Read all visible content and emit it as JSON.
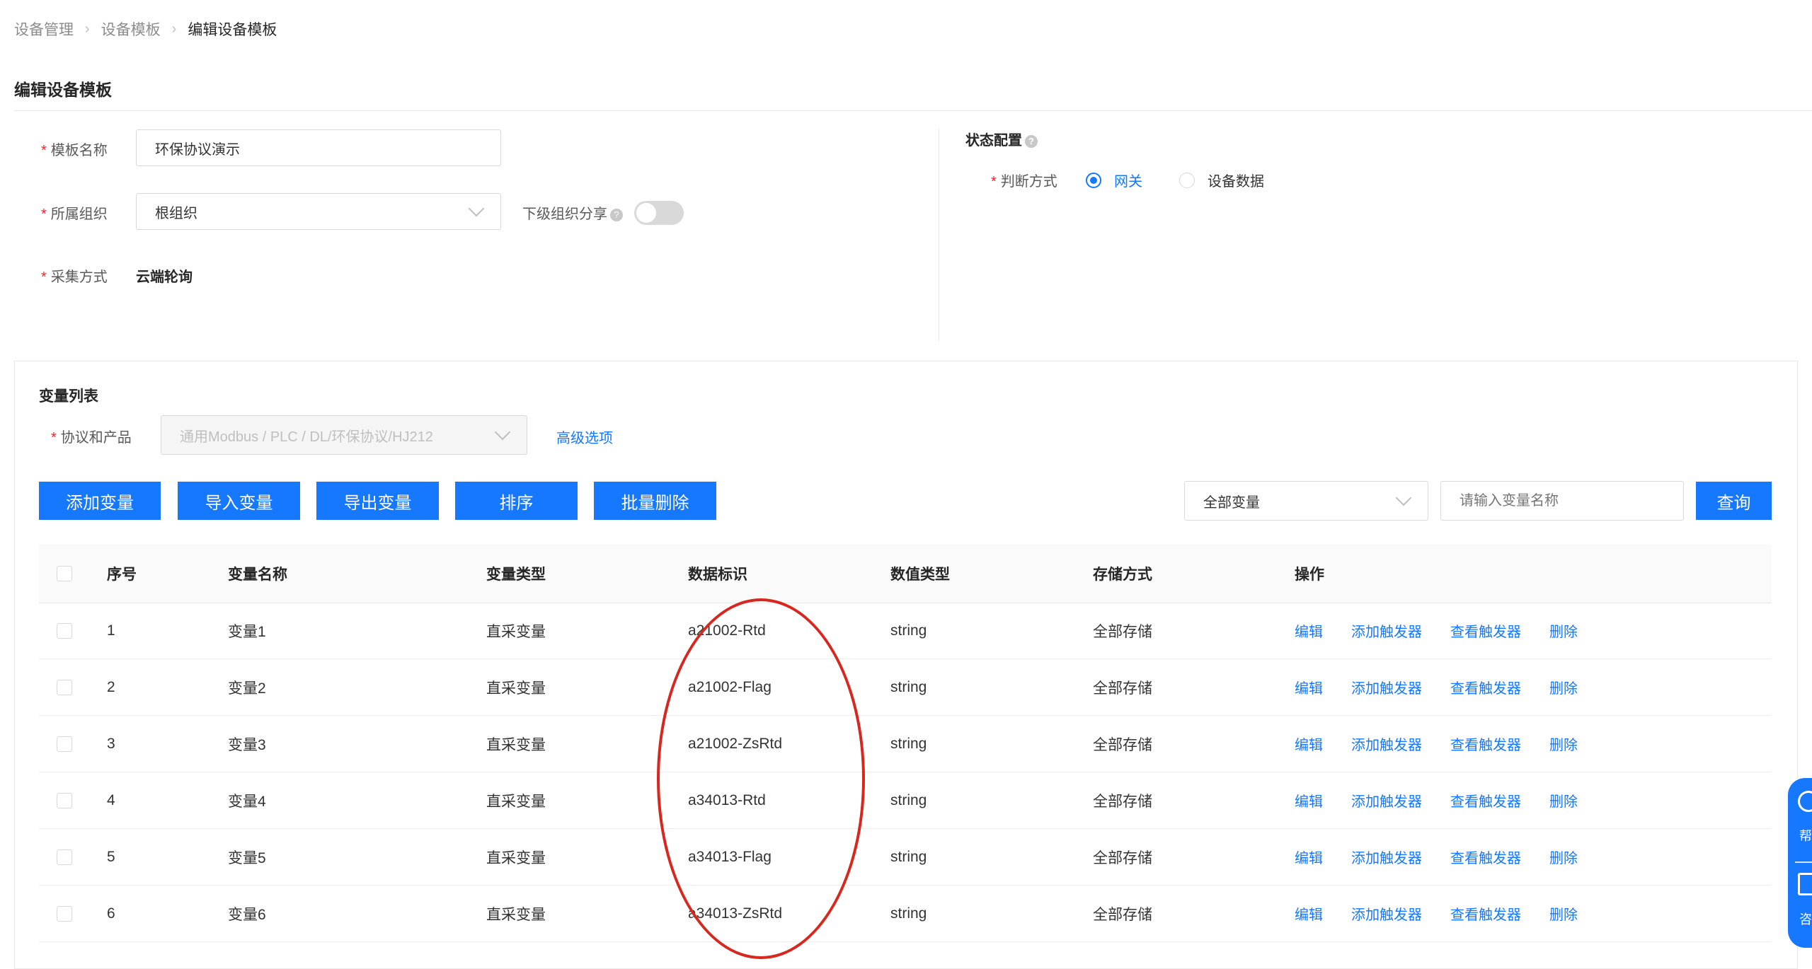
{
  "breadcrumb": {
    "items": [
      "设备管理",
      "设备模板"
    ],
    "current": "编辑设备模板"
  },
  "page": {
    "title": "编辑设备模板"
  },
  "form": {
    "template_name": {
      "label": "模板名称",
      "value": "环保协议演示"
    },
    "org": {
      "label": "所属组织",
      "value": "根组织"
    },
    "sub_share": {
      "label": "下级组织分享",
      "enabled": false
    },
    "collect": {
      "label": "采集方式",
      "value": "云端轮询"
    }
  },
  "status_config": {
    "title": "状态配置",
    "judge_label": "判断方式",
    "options": [
      {
        "label": "网关",
        "selected": true
      },
      {
        "label": "设备数据",
        "selected": false
      }
    ]
  },
  "variables": {
    "section_title": "变量列表",
    "protocol": {
      "label": "协议和产品",
      "placeholder": "通用Modbus / PLC / DL/环保协议/HJ212"
    },
    "advanced_link": "高级选项",
    "buttons": {
      "add": "添加变量",
      "import": "导入变量",
      "export": "导出变量",
      "sort": "排序",
      "batch_delete": "批量删除"
    },
    "filter": {
      "value": "全部变量"
    },
    "search": {
      "placeholder": "请输入变量名称",
      "button": "查询"
    },
    "columns": [
      "序号",
      "变量名称",
      "变量类型",
      "数据标识",
      "数值类型",
      "存储方式",
      "操作"
    ],
    "actions": [
      "编辑",
      "添加触发器",
      "查看触发器",
      "删除"
    ],
    "rows": [
      {
        "index": "1",
        "name": "变量1",
        "var_type": "直采变量",
        "data_id": "a21002-Rtd",
        "value_type": "string",
        "storage": "全部存储"
      },
      {
        "index": "2",
        "name": "变量2",
        "var_type": "直采变量",
        "data_id": "a21002-Flag",
        "value_type": "string",
        "storage": "全部存储"
      },
      {
        "index": "3",
        "name": "变量3",
        "var_type": "直采变量",
        "data_id": "a21002-ZsRtd",
        "value_type": "string",
        "storage": "全部存储"
      },
      {
        "index": "4",
        "name": "变量4",
        "var_type": "直采变量",
        "data_id": "a34013-Rtd",
        "value_type": "string",
        "storage": "全部存储"
      },
      {
        "index": "5",
        "name": "变量5",
        "var_type": "直采变量",
        "data_id": "a34013-Flag",
        "value_type": "string",
        "storage": "全部存储"
      },
      {
        "index": "6",
        "name": "变量6",
        "var_type": "直采变量",
        "data_id": "a34013-ZsRtd",
        "value_type": "string",
        "storage": "全部存储"
      }
    ]
  },
  "float_panel": {
    "help_label": "帮",
    "consult_label": "咨"
  },
  "colors": {
    "primary": "#1677ff",
    "annotation": "#d6281f",
    "required": "#f5222d"
  }
}
